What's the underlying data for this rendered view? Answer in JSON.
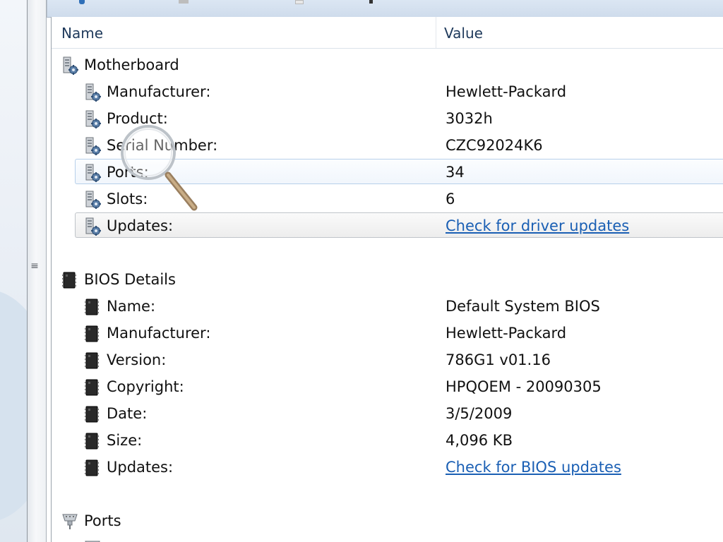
{
  "window": {
    "title": ""
  },
  "columns": {
    "name": "Name",
    "value": "Value"
  },
  "sections": {
    "motherboard": {
      "title": "Motherboard",
      "icon": "motherboard-icon",
      "rows": [
        {
          "label": "Manufacturer:",
          "value": "Hewlett-Packard"
        },
        {
          "label": "Product:",
          "value": "3032h"
        },
        {
          "label": "Serial Number:",
          "value": "CZC92024K6"
        },
        {
          "label": "Ports:",
          "value": "34"
        },
        {
          "label": "Slots:",
          "value": "6"
        },
        {
          "label": "Updates:",
          "value": "Check for driver updates"
        }
      ]
    },
    "bios": {
      "title": "BIOS Details",
      "icon": "bios-chip-icon",
      "rows": [
        {
          "label": "Name:",
          "value": "Default System BIOS"
        },
        {
          "label": "Manufacturer:",
          "value": "Hewlett-Packard"
        },
        {
          "label": "Version:",
          "value": "786G1 v01.16"
        },
        {
          "label": "Copyright:",
          "value": "HPQOEM - 20090305"
        },
        {
          "label": "Date:",
          "value": "3/5/2009"
        },
        {
          "label": "Size:",
          "value": "4,096 KB"
        },
        {
          "label": "Updates:",
          "value": "Check for BIOS updates"
        }
      ]
    },
    "ports": {
      "title": "Ports",
      "icon": "port-connector-icon"
    }
  },
  "splitter": {
    "grip": "≡"
  },
  "colors": {
    "link": "#1a5fb4",
    "header_text": "#1e395b",
    "selection_border": "#b7d0ea"
  }
}
